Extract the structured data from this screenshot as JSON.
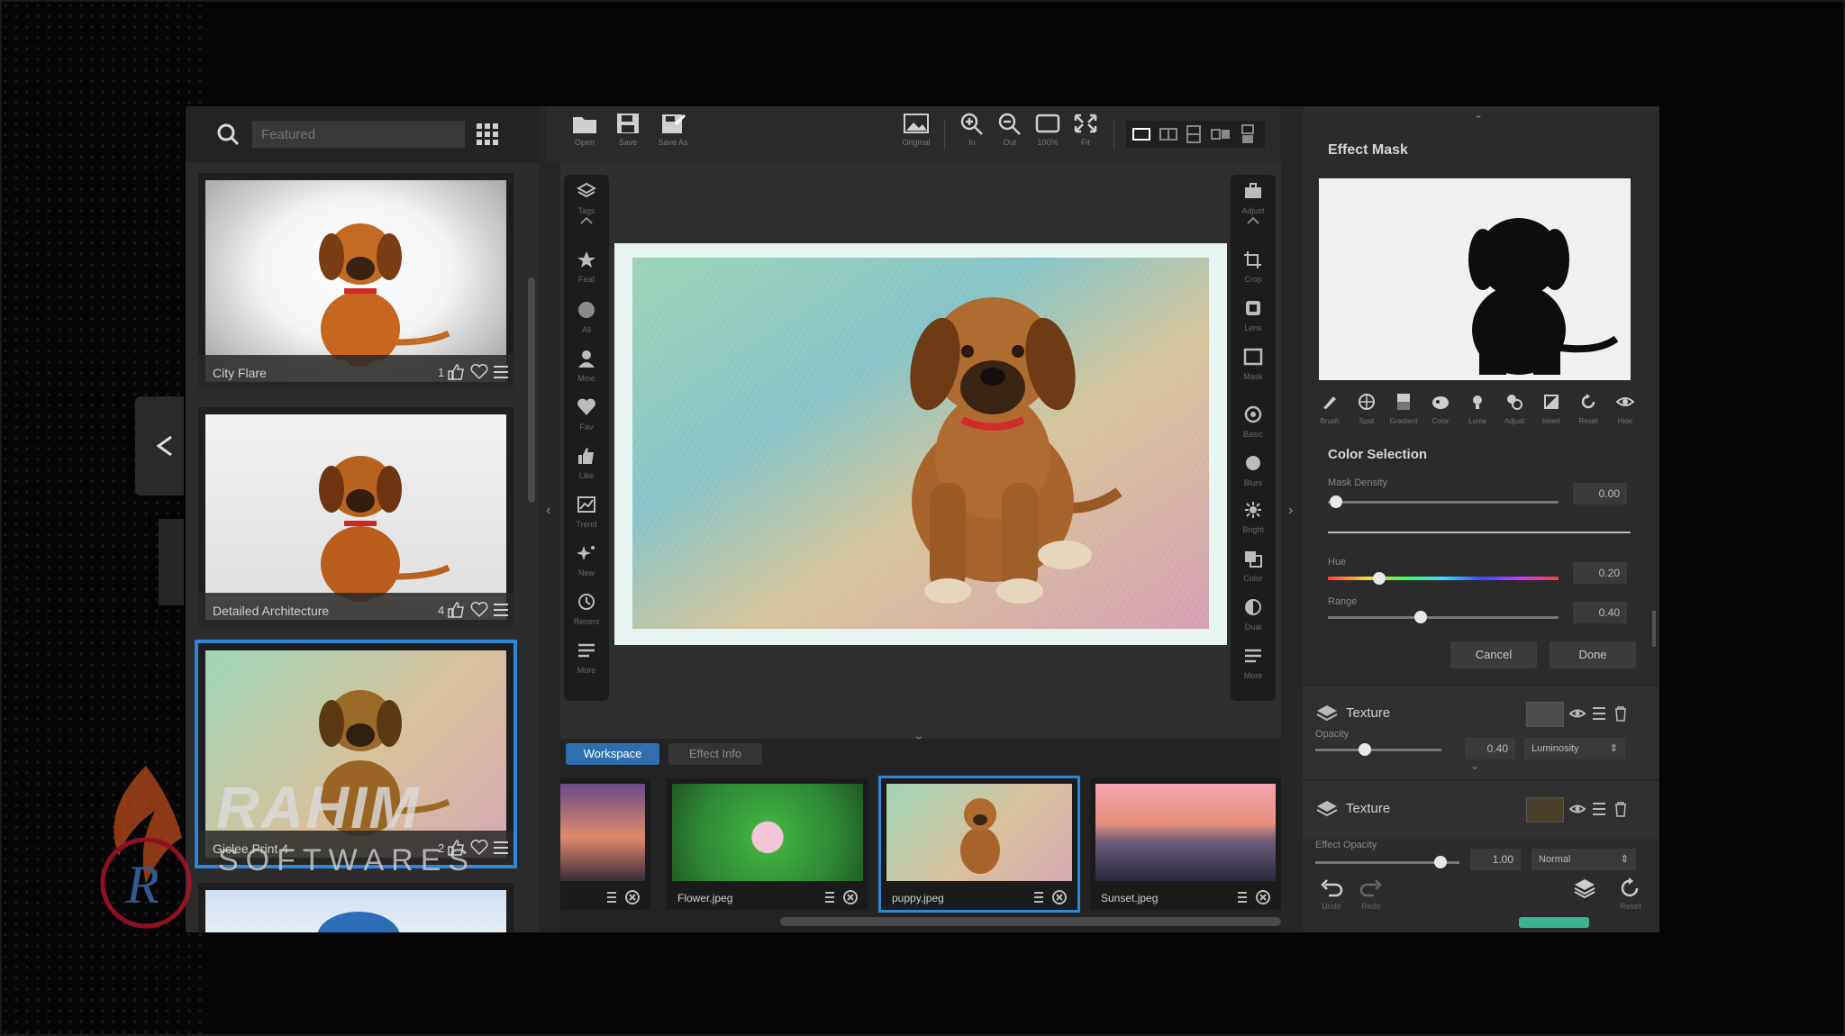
{
  "left_panel": {
    "search_placeholder": "Featured",
    "thumbnails": [
      {
        "name": "City Flare",
        "likes": "1"
      },
      {
        "name": "Detailed Architecture",
        "likes": "4"
      },
      {
        "name": "Giclee Print 4",
        "likes": "2"
      }
    ]
  },
  "toolbar": {
    "open": "Open",
    "save": "Save",
    "save_as": "Save As",
    "original": "Original",
    "zoom_in": "In",
    "zoom_out": "Out",
    "zoom_100": "100%",
    "fit": "Fit"
  },
  "left_tools": [
    {
      "label": "Tags"
    },
    {
      "label": "Feat"
    },
    {
      "label": "All"
    },
    {
      "label": "Mine"
    },
    {
      "label": "Fav"
    },
    {
      "label": "Like"
    },
    {
      "label": "Trend"
    },
    {
      "label": "New"
    },
    {
      "label": "Recent"
    },
    {
      "label": "More"
    }
  ],
  "right_tools": [
    {
      "label": "Adjust"
    },
    {
      "label": "Crop"
    },
    {
      "label": "Lens"
    },
    {
      "label": "Mask"
    },
    {
      "label": "Basic"
    },
    {
      "label": "Blurs"
    },
    {
      "label": "Bright"
    },
    {
      "label": "Color"
    },
    {
      "label": "Dual"
    },
    {
      "label": "More"
    }
  ],
  "tabs": {
    "workspace": "Workspace",
    "effect_info": "Effect Info"
  },
  "filmstrip": [
    {
      "name": ""
    },
    {
      "name": "Flower.jpeg"
    },
    {
      "name": "puppy.jpeg"
    },
    {
      "name": "Sunset.jpeg"
    }
  ],
  "effect_mask": {
    "title": "Effect Mask",
    "tools": [
      "Brush",
      "Spot",
      "Gradient",
      "Color",
      "Luma",
      "Adjust",
      "Invert",
      "Reset",
      "Hide"
    ],
    "color_selection_title": "Color Selection",
    "mask_density_label": "Mask Density",
    "mask_density_value": "0.00",
    "hue_label": "Hue",
    "hue_value": "0.20",
    "range_label": "Range",
    "range_value": "0.40",
    "cancel": "Cancel",
    "done": "Done"
  },
  "layers": [
    {
      "name": "Texture",
      "opacity_label": "Opacity",
      "opacity_value": "0.40",
      "blend": "Luminosity"
    },
    {
      "name": "Texture"
    }
  ],
  "effect_opacity": {
    "label": "Effect Opacity",
    "value": "1.00",
    "blend": "Normal"
  },
  "bottom": {
    "undo": "Undo",
    "redo": "Redo",
    "reset": "Reset"
  },
  "watermark": {
    "name": "RAHIM",
    "sub": "SOFTWARES",
    "monogram": "R"
  }
}
